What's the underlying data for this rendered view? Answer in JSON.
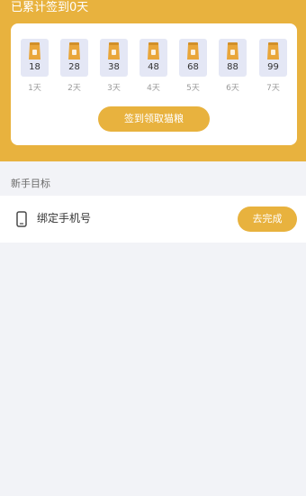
{
  "header": {
    "streak_title": "已累计签到0天"
  },
  "checkin": {
    "days": [
      {
        "reward": "18",
        "label": "1天"
      },
      {
        "reward": "28",
        "label": "2天"
      },
      {
        "reward": "38",
        "label": "3天"
      },
      {
        "reward": "48",
        "label": "4天"
      },
      {
        "reward": "68",
        "label": "5天"
      },
      {
        "reward": "88",
        "label": "6天"
      },
      {
        "reward": "99",
        "label": "7天"
      }
    ],
    "claim_button_label": "签到领取猫粮"
  },
  "tasks": {
    "section_title": "新手目标",
    "items": [
      {
        "icon": "phone-icon",
        "label": "绑定手机号",
        "button_label": "去完成"
      }
    ]
  },
  "colors": {
    "accent": "#e8b23e",
    "tile_background": "#e4e7f5",
    "bag": "#e9a63a",
    "page_background": "#f2f3f7"
  }
}
